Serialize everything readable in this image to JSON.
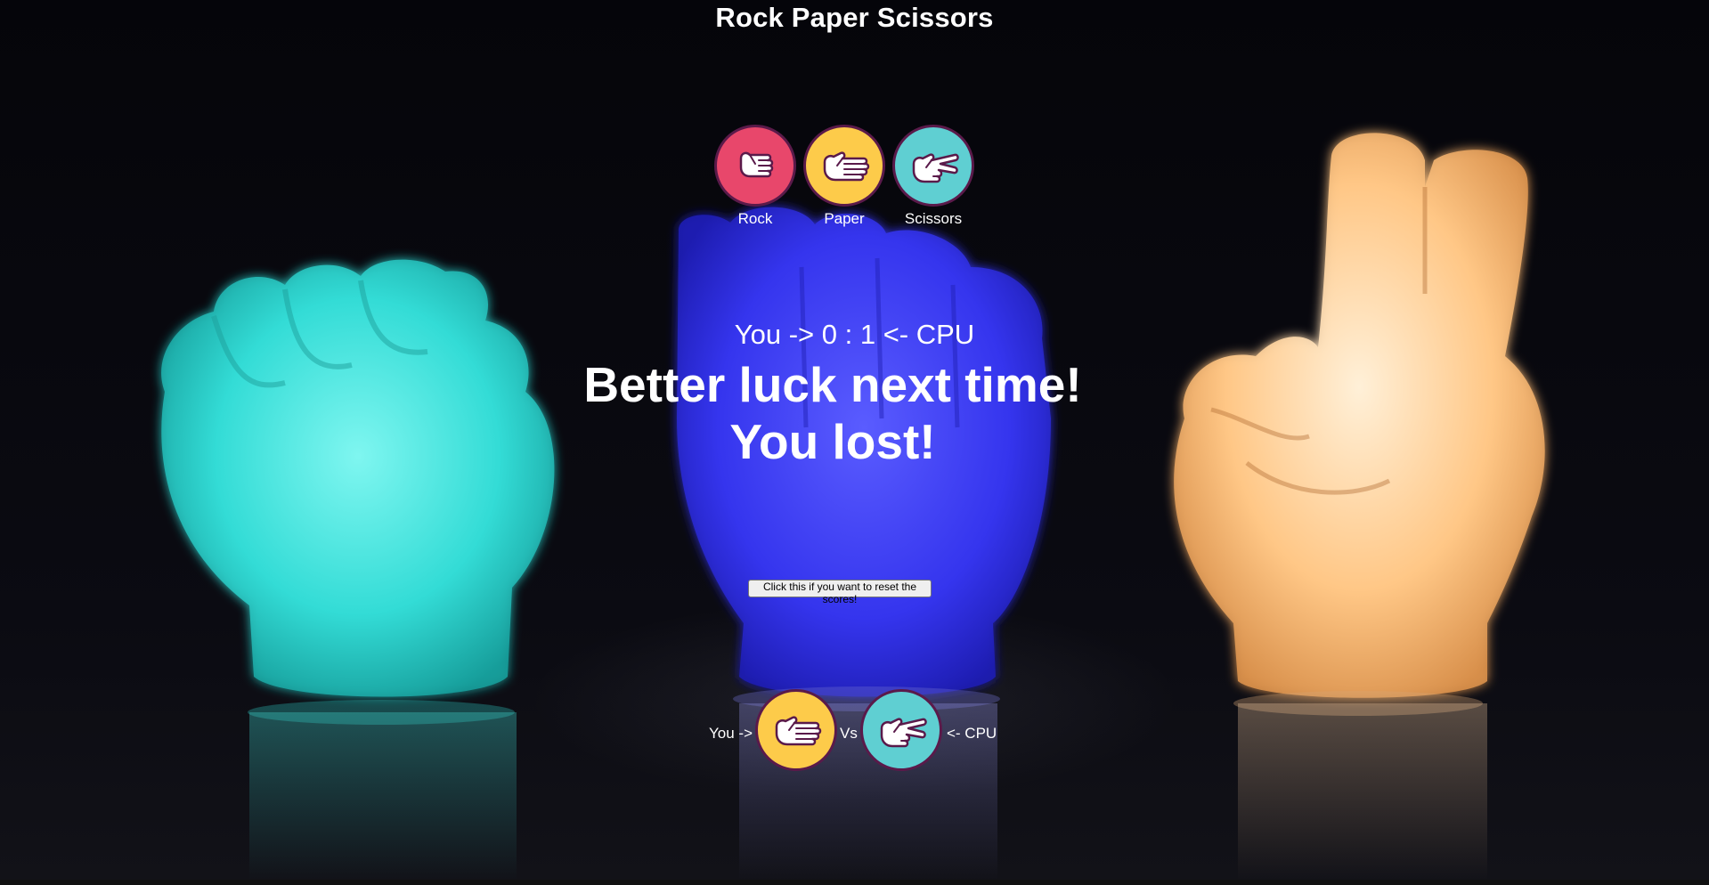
{
  "title": "Rock Paper Scissors",
  "choices": [
    {
      "label": "Rock",
      "icon": "rock-hand-icon",
      "color": "#e8476b"
    },
    {
      "label": "Paper",
      "icon": "paper-hand-icon",
      "color": "#fdcb4a"
    },
    {
      "label": "Scissors",
      "icon": "scissors-hand-icon",
      "color": "#5fcfd2"
    }
  ],
  "score": "You -> 0 : 1 <- CPU",
  "result": {
    "line1": "Better luck next time!",
    "line2": "You lost!"
  },
  "reset_label": "Click this if you want to reset the scores!",
  "versus": {
    "you_label": "You ->",
    "vs_label": "Vs",
    "cpu_label": "<- CPU",
    "player_choice": {
      "icon": "paper-hand-icon",
      "color": "#fdcb4a"
    },
    "cpu_choice": {
      "icon": "scissors-hand-icon",
      "color": "#5fcfd2"
    }
  },
  "colors": {
    "background": "#030306",
    "text": "#ffffff",
    "fist_figure": "#3ee6df",
    "palm_figure": "#3a3af5",
    "peace_figure": "#ffc78a"
  }
}
